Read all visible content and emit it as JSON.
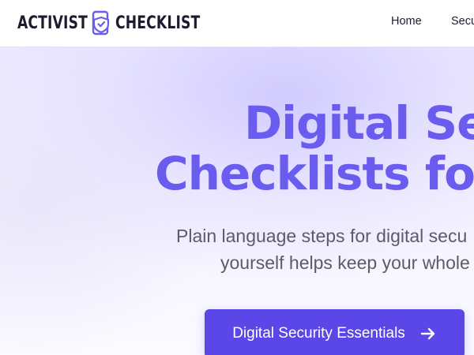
{
  "header": {
    "logo": {
      "word1": "ACTIVIST",
      "word2": "CHECKLIST",
      "icon": "shield-phone-icon"
    },
    "nav": [
      {
        "label": "Home"
      },
      {
        "label": "Secu"
      }
    ]
  },
  "hero": {
    "title_line1": "Digital Se",
    "title_line2": "Checklists for",
    "subtitle_line1": "Plain language steps for digital secu",
    "subtitle_line2": "yourself helps keep your whole",
    "cta_label": "Digital Security Essentials",
    "cta_icon": "arrow-right-icon"
  },
  "colors": {
    "accent": "#6b5cf0",
    "button": "#5b46e8",
    "text_dark": "#1e1b2e",
    "text_muted": "#5c5a6b"
  }
}
